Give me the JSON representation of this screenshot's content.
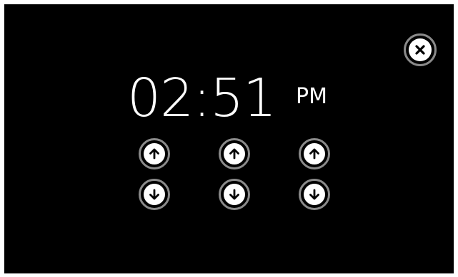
{
  "clock": {
    "time": "02:51",
    "meridiem": "PM"
  },
  "controls": {
    "icons": {
      "close": "close-icon",
      "up": "arrow-up-icon",
      "down": "arrow-down-icon"
    }
  },
  "colors": {
    "background": "#000000",
    "foreground": "#ffffff",
    "ring": "#8a8a8a"
  }
}
